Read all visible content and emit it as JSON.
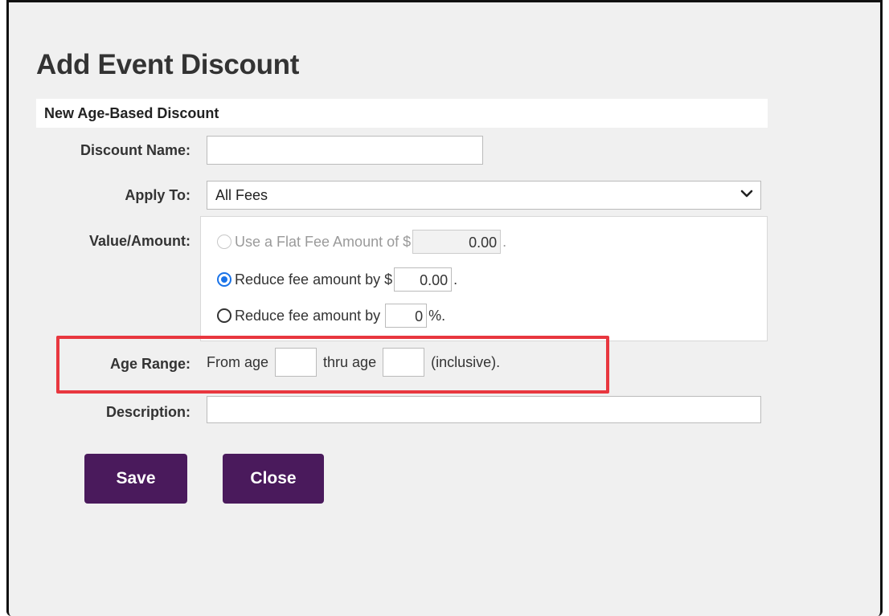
{
  "dialog": {
    "title": "Add Event Discount",
    "section_title": "New Age-Based Discount"
  },
  "fields": {
    "discount_name": {
      "label": "Discount Name:",
      "value": ""
    },
    "apply_to": {
      "label": "Apply To:",
      "selected": "All Fees"
    },
    "value_amount": {
      "label": "Value/Amount:",
      "options": [
        {
          "text_before": "Use a Flat Fee Amount of $",
          "value": "0.00",
          "text_after": ".",
          "state": "disabled"
        },
        {
          "text_before": "Reduce fee amount by $",
          "value": "0.00",
          "text_after": ".",
          "state": "checked"
        },
        {
          "text_before": "Reduce fee amount by",
          "value": "0",
          "text_after": "%.",
          "state": "unchecked"
        }
      ]
    },
    "age_range": {
      "label": "Age Range:",
      "from_text": "From age",
      "from_value": "",
      "thru_text": "thru age",
      "thru_value": "",
      "suffix": "(inclusive)."
    },
    "description": {
      "label": "Description:",
      "value": ""
    }
  },
  "buttons": {
    "save": "Save",
    "close": "Close"
  },
  "colors": {
    "button_bg": "#4a1a5c",
    "highlight_border": "#e8373f",
    "radio_checked": "#1a73e8"
  },
  "icons": {
    "select_arrow": "chevron-down-icon"
  }
}
